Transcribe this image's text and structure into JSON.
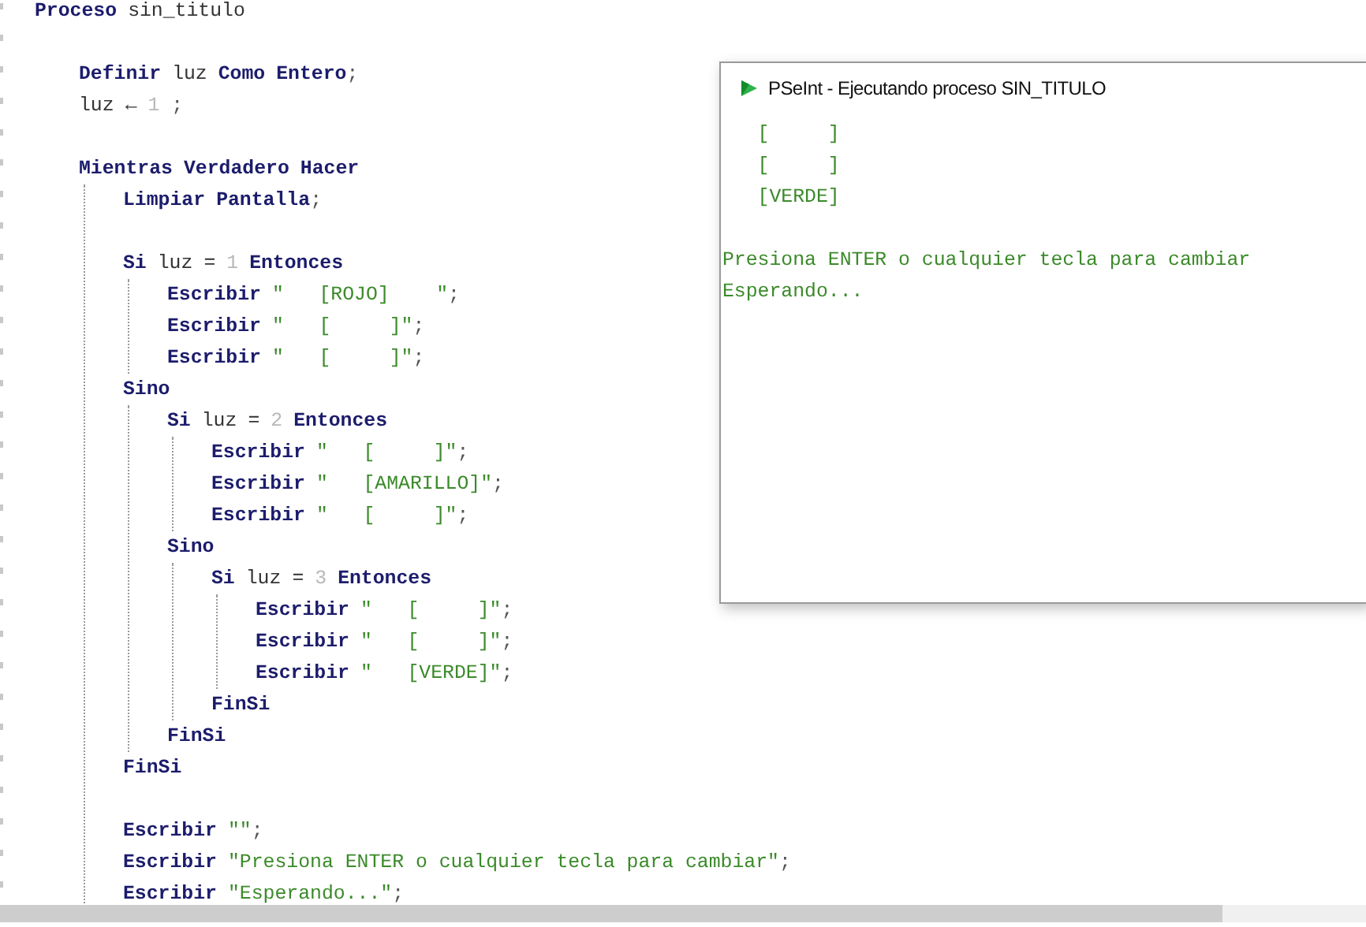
{
  "editor": {
    "lines": [
      {
        "tokens": [
          {
            "kind": "kw",
            "text": "Proceso"
          },
          {
            "kind": "id",
            "text": "sin_titulo"
          }
        ],
        "children": [
          {
            "blank_before": true,
            "tokens": [
              {
                "kind": "kw",
                "text": "Definir"
              },
              {
                "kind": "id",
                "text": "luz"
              },
              {
                "kind": "kw",
                "text": "Como"
              },
              {
                "kind": "kw",
                "text": "Entero"
              },
              {
                "kind": "punct",
                "text": ";"
              }
            ]
          },
          {
            "tokens": [
              {
                "kind": "id",
                "text": "luz"
              },
              {
                "kind": "op",
                "text": "←"
              },
              {
                "kind": "num",
                "text": "1"
              },
              {
                "kind": "punct",
                "text": " ;"
              }
            ]
          },
          {
            "blank_before": true,
            "tokens": [
              {
                "kind": "kw",
                "text": "Mientras"
              },
              {
                "kind": "kw",
                "text": "Verdadero"
              },
              {
                "kind": "kw",
                "text": "Hacer"
              }
            ],
            "children": [
              {
                "tokens": [
                  {
                    "kind": "kw",
                    "text": "Limpiar"
                  },
                  {
                    "kind": "kw",
                    "text": "Pantalla"
                  },
                  {
                    "kind": "punct",
                    "text": ";"
                  }
                ]
              },
              {
                "blank_before": true,
                "tokens": [
                  {
                    "kind": "kw",
                    "text": "Si"
                  },
                  {
                    "kind": "id",
                    "text": "luz"
                  },
                  {
                    "kind": "op",
                    "text": "="
                  },
                  {
                    "kind": "num",
                    "text": "1"
                  },
                  {
                    "kind": "kw",
                    "text": "Entonces"
                  }
                ],
                "children": [
                  {
                    "tokens": [
                      {
                        "kind": "kw",
                        "text": "Escribir"
                      },
                      {
                        "kind": "str",
                        "text": "\"   [ROJO]    \""
                      },
                      {
                        "kind": "punct",
                        "text": ";"
                      }
                    ]
                  },
                  {
                    "tokens": [
                      {
                        "kind": "kw",
                        "text": "Escribir"
                      },
                      {
                        "kind": "str",
                        "text": "\"   [     ]\""
                      },
                      {
                        "kind": "punct",
                        "text": ";"
                      }
                    ]
                  },
                  {
                    "tokens": [
                      {
                        "kind": "kw",
                        "text": "Escribir"
                      },
                      {
                        "kind": "str",
                        "text": "\"   [     ]\""
                      },
                      {
                        "kind": "punct",
                        "text": ";"
                      }
                    ]
                  }
                ]
              },
              {
                "tokens": [
                  {
                    "kind": "kw",
                    "text": "Sino"
                  }
                ],
                "children": [
                  {
                    "tokens": [
                      {
                        "kind": "kw",
                        "text": "Si"
                      },
                      {
                        "kind": "id",
                        "text": "luz"
                      },
                      {
                        "kind": "op",
                        "text": "="
                      },
                      {
                        "kind": "num",
                        "text": "2"
                      },
                      {
                        "kind": "kw",
                        "text": "Entonces"
                      }
                    ],
                    "children": [
                      {
                        "tokens": [
                          {
                            "kind": "kw",
                            "text": "Escribir"
                          },
                          {
                            "kind": "str",
                            "text": "\"   [     ]\""
                          },
                          {
                            "kind": "punct",
                            "text": ";"
                          }
                        ]
                      },
                      {
                        "tokens": [
                          {
                            "kind": "kw",
                            "text": "Escribir"
                          },
                          {
                            "kind": "str",
                            "text": "\"   [AMARILLO]\""
                          },
                          {
                            "kind": "punct",
                            "text": ";"
                          }
                        ]
                      },
                      {
                        "tokens": [
                          {
                            "kind": "kw",
                            "text": "Escribir"
                          },
                          {
                            "kind": "str",
                            "text": "\"   [     ]\""
                          },
                          {
                            "kind": "punct",
                            "text": ";"
                          }
                        ]
                      }
                    ]
                  },
                  {
                    "tokens": [
                      {
                        "kind": "kw",
                        "text": "Sino"
                      }
                    ],
                    "children": [
                      {
                        "tokens": [
                          {
                            "kind": "kw",
                            "text": "Si"
                          },
                          {
                            "kind": "id",
                            "text": "luz"
                          },
                          {
                            "kind": "op",
                            "text": "="
                          },
                          {
                            "kind": "num",
                            "text": "3"
                          },
                          {
                            "kind": "kw",
                            "text": "Entonces"
                          }
                        ],
                        "children": [
                          {
                            "tokens": [
                              {
                                "kind": "kw",
                                "text": "Escribir"
                              },
                              {
                                "kind": "str",
                                "text": "\"   [     ]\""
                              },
                              {
                                "kind": "punct",
                                "text": ";"
                              }
                            ]
                          },
                          {
                            "tokens": [
                              {
                                "kind": "kw",
                                "text": "Escribir"
                              },
                              {
                                "kind": "str",
                                "text": "\"   [     ]\""
                              },
                              {
                                "kind": "punct",
                                "text": ";"
                              }
                            ]
                          },
                          {
                            "tokens": [
                              {
                                "kind": "kw",
                                "text": "Escribir"
                              },
                              {
                                "kind": "str",
                                "text": "\"   [VERDE]\""
                              },
                              {
                                "kind": "punct",
                                "text": ";"
                              }
                            ]
                          }
                        ]
                      },
                      {
                        "tokens": [
                          {
                            "kind": "kw",
                            "text": "FinSi"
                          }
                        ]
                      }
                    ]
                  },
                  {
                    "tokens": [
                      {
                        "kind": "kw",
                        "text": "FinSi"
                      }
                    ]
                  }
                ]
              },
              {
                "tokens": [
                  {
                    "kind": "kw",
                    "text": "FinSi"
                  }
                ]
              },
              {
                "blank_before": true,
                "tokens": [
                  {
                    "kind": "kw",
                    "text": "Escribir"
                  },
                  {
                    "kind": "str",
                    "text": "\"\""
                  },
                  {
                    "kind": "punct",
                    "text": ";"
                  }
                ]
              },
              {
                "tokens": [
                  {
                    "kind": "kw",
                    "text": "Escribir"
                  },
                  {
                    "kind": "str",
                    "text": "\"Presiona ENTER o cualquier tecla para cambiar\""
                  },
                  {
                    "kind": "punct",
                    "text": ";"
                  }
                ]
              },
              {
                "tokens": [
                  {
                    "kind": "kw",
                    "text": "Escribir"
                  },
                  {
                    "kind": "str",
                    "text": "\"Esperando...\""
                  },
                  {
                    "kind": "punct",
                    "text": ";"
                  }
                ]
              }
            ]
          }
        ]
      }
    ]
  },
  "run_window": {
    "title": "PSeInt - Ejecutando proceso SIN_TITULO",
    "output": [
      {
        "text": "   [     ]"
      },
      {
        "text": "   [     ]"
      },
      {
        "text": "   [VERDE]"
      },
      {
        "blank_before": true,
        "text": "Presiona ENTER o cualquier tecla para cambiar"
      },
      {
        "text": "Esperando..."
      }
    ]
  }
}
